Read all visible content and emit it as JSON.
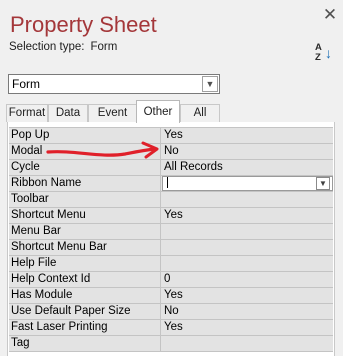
{
  "panel": {
    "title": "Property Sheet",
    "close_glyph": "✕",
    "selection_type_label": "Selection type:",
    "selection_type_value": "Form",
    "sort_icon": "sort-az-icon"
  },
  "object_selector": {
    "value": "Form"
  },
  "tabs": [
    {
      "label": "Format",
      "active": false
    },
    {
      "label": "Data",
      "active": false
    },
    {
      "label": "Event",
      "active": false
    },
    {
      "label": "Other",
      "active": true
    },
    {
      "label": "All",
      "active": false
    }
  ],
  "properties": [
    {
      "name": "Pop Up",
      "value": "Yes"
    },
    {
      "name": "Modal",
      "value": "No"
    },
    {
      "name": "Cycle",
      "value": "All Records"
    },
    {
      "name": "Ribbon Name",
      "value": ""
    },
    {
      "name": "Toolbar",
      "value": ""
    },
    {
      "name": "Shortcut Menu",
      "value": "Yes"
    },
    {
      "name": "Menu Bar",
      "value": ""
    },
    {
      "name": "Shortcut Menu Bar",
      "value": ""
    },
    {
      "name": "Help File",
      "value": ""
    },
    {
      "name": "Help Context Id",
      "value": "0"
    },
    {
      "name": "Has Module",
      "value": "Yes"
    },
    {
      "name": "Use Default Paper Size",
      "value": "No"
    },
    {
      "name": "Fast Laser Printing",
      "value": "Yes"
    },
    {
      "name": "Tag",
      "value": ""
    }
  ],
  "colors": {
    "title": "#a4373a",
    "annotation_arrow": "#e0202a",
    "grid_row": "#e3e3e3"
  }
}
